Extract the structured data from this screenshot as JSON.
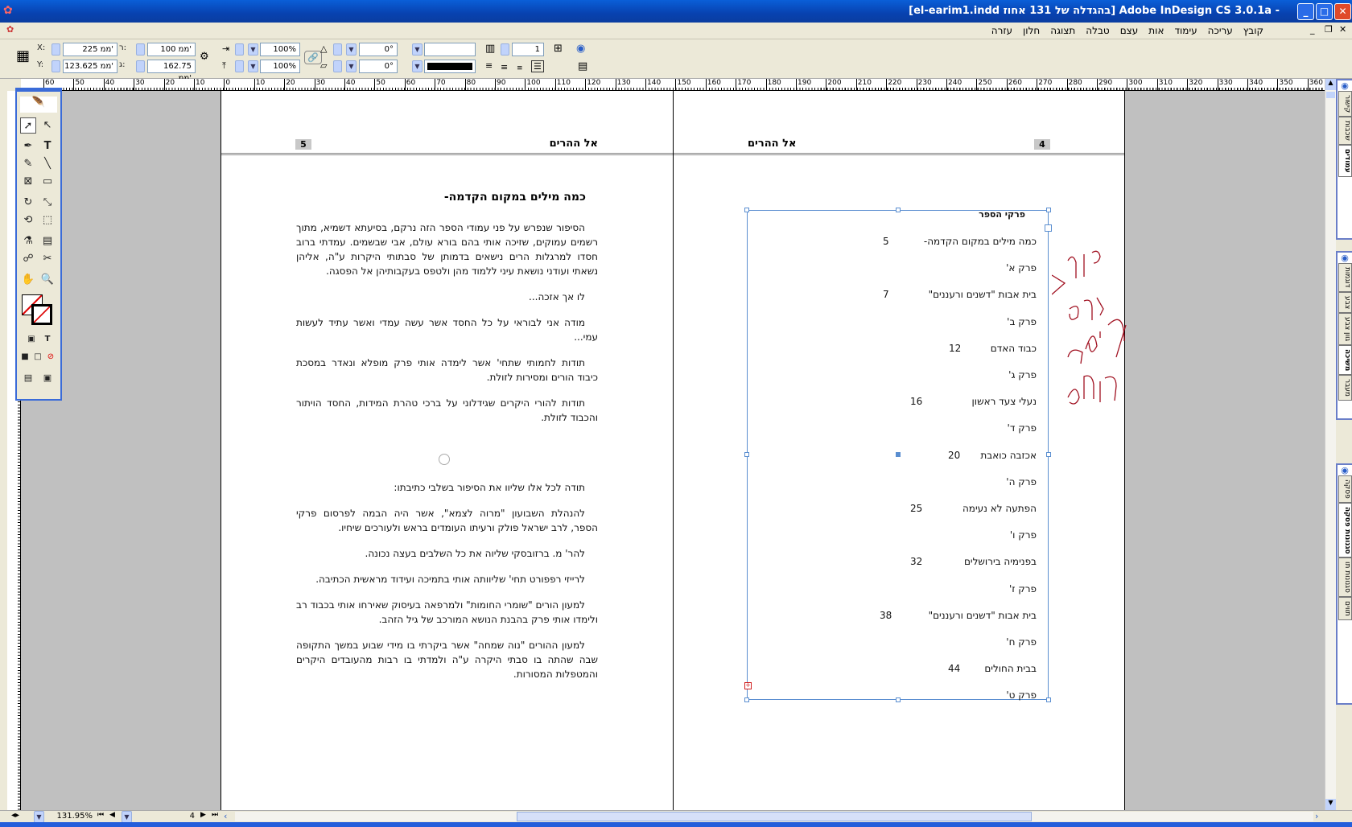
{
  "window": {
    "title": "[el-earim1.indd בהגדלה של 131 אחוז] Adobe InDesign CS 3.0.1a - ",
    "minimize": "_",
    "maximize": "□",
    "close": "✕"
  },
  "menu": [
    "קובץ",
    "עריכה",
    "עימוד",
    "אות",
    "עצם",
    "טבלה",
    "תצוגה",
    "חלון",
    "עזרה"
  ],
  "control": {
    "x_label": "X:",
    "x": "225 ממ'",
    "y_label": "Y:",
    "y": "123.625 ממ'",
    "w_label": "ר:",
    "w": "100 ממ'",
    "h_label": "ג:",
    "h": "162.75 ממ'",
    "scale_x": "100%",
    "scale_y": "100%",
    "rotate": "0°",
    "shear": "0°",
    "columns": "1"
  },
  "ruler": {
    "ticks": [
      "60",
      "50",
      "40",
      "30",
      "20",
      "10",
      "0",
      "10",
      "20",
      "30",
      "40",
      "50",
      "60",
      "70",
      "80",
      "90",
      "100",
      "110",
      "120",
      "130",
      "140",
      "150",
      "160",
      "170",
      "180",
      "190",
      "200",
      "210",
      "220",
      "230",
      "240",
      "250",
      "260",
      "270",
      "280",
      "290",
      "300",
      "310",
      "320",
      "330",
      "340",
      "350",
      "360"
    ]
  },
  "left_page": {
    "header": "אל ההרים",
    "page_number": "5",
    "heading": "כמה מילים במקום הקדמה-",
    "paragraphs": [
      "הסיפור שנפרש על פני עמודי הספר הזה נרקם, בסיעתא דשמיא, מתוך רשמים עמוקים, שזיכה אותי בהם בורא עולם, אבי שבשמים. עמדתי ברוב חסדו למרגלות הרים נישאים בדמותן של סבתותי היקרות ע\"ה, אליהן נשאתי ועודני נושאת עיני ללמוד מהן ולטפס בעקבותיהן אל הפסגה.",
      "לו אך אזכה...",
      "מודה אני לבוראי על כל החסד אשר עשה עמדי ואשר עתיד לעשות עמי...",
      "תודות לחמותי שתחי' אשר לימדה אותי פרק מופלא ונאדר במסכת כיבוד הורים ומסירות לזולת.",
      "תודות להורי היקרים שגידלוני על ברכי טהרת המידות, החסד הויתור והכבוד לזולת."
    ],
    "paragraphs2": [
      "תודה לכל אלו שליוו את הסיפור בשלבי כתיבתו:",
      "להנהלת השבועון \"מרוה לצמא\", אשר היה הבמה לפרסום פרקי הספר, לרב ישראל פולק ורעיתו העומדים בראש ולעורכים שיחיו.",
      "להר' מ. ברזובסקי שליוה את כל השלבים בעצה נכונה.",
      "לרייזי רפפורט תחי' שליוותה אותי בתמיכה ועידוד מראשית הכתיבה.",
      "למעון הורים \"שומרי החומות\" ולמרפאה בעיסוק שאירחו אותי בכבוד רב ולימדו אותי פרק בהבנת הנושא המורכב של גיל הזהב.",
      "למעון ההורים \"נוה שמחה\" אשר ביקרתי בו מידי שבוע במשך התקופה שבה שהתה בו סבתי היקרה ע\"ה ולמדתי בו רבות מהעובדים היקרים והמטפלות המסורות."
    ]
  },
  "right_page": {
    "header": "אל ההרים",
    "page_number": "4",
    "toc_title": "פרקי הספר",
    "toc": [
      {
        "title": "כמה מילים במקום הקדמה-",
        "page": "5"
      },
      {
        "title": "פרק א'",
        "page": ""
      },
      {
        "title": "בית אבות \"דשנים ורעננים\"",
        "page": "7"
      },
      {
        "title": "פרק ב'",
        "page": ""
      },
      {
        "title": "כבוד האדם",
        "page": "12"
      },
      {
        "title": "פרק ג'",
        "page": ""
      },
      {
        "title": "נעלי צעד ראשון",
        "page": "16"
      },
      {
        "title": "פרק ד'",
        "page": ""
      },
      {
        "title": "אכזבה כואבת",
        "page": "20"
      },
      {
        "title": "פרק ה'",
        "page": ""
      },
      {
        "title": "הפתעה לא נעימה",
        "page": "25"
      },
      {
        "title": "פרק ו'",
        "page": ""
      },
      {
        "title": "בפנימיה בירושלים",
        "page": "32"
      },
      {
        "title": "פרק ז'",
        "page": ""
      },
      {
        "title": "בית אבות \"דשנים ורעננים\"",
        "page": "38"
      },
      {
        "title": "פרק ח'",
        "page": ""
      },
      {
        "title": "בבית החולים",
        "page": "44"
      },
      {
        "title": "פרק ט'",
        "page": ""
      }
    ],
    "annotation_color": "#a01020"
  },
  "panels": [
    [
      "קישור",
      "שכבות",
      "עמודים"
    ],
    [
      "דוגמות",
      "צבע",
      "גוון צבע",
      "משיכה",
      "מעבר"
    ],
    [
      "פסקה",
      "סגנונות פסקה",
      "סגנונות תו",
      "תווים"
    ]
  ],
  "status": {
    "zoom": "131.95%",
    "page": "4"
  },
  "colors": {
    "titlebar": "#0842b0",
    "frame": "#5a8ed0",
    "canvas": "#c0c0c0"
  }
}
